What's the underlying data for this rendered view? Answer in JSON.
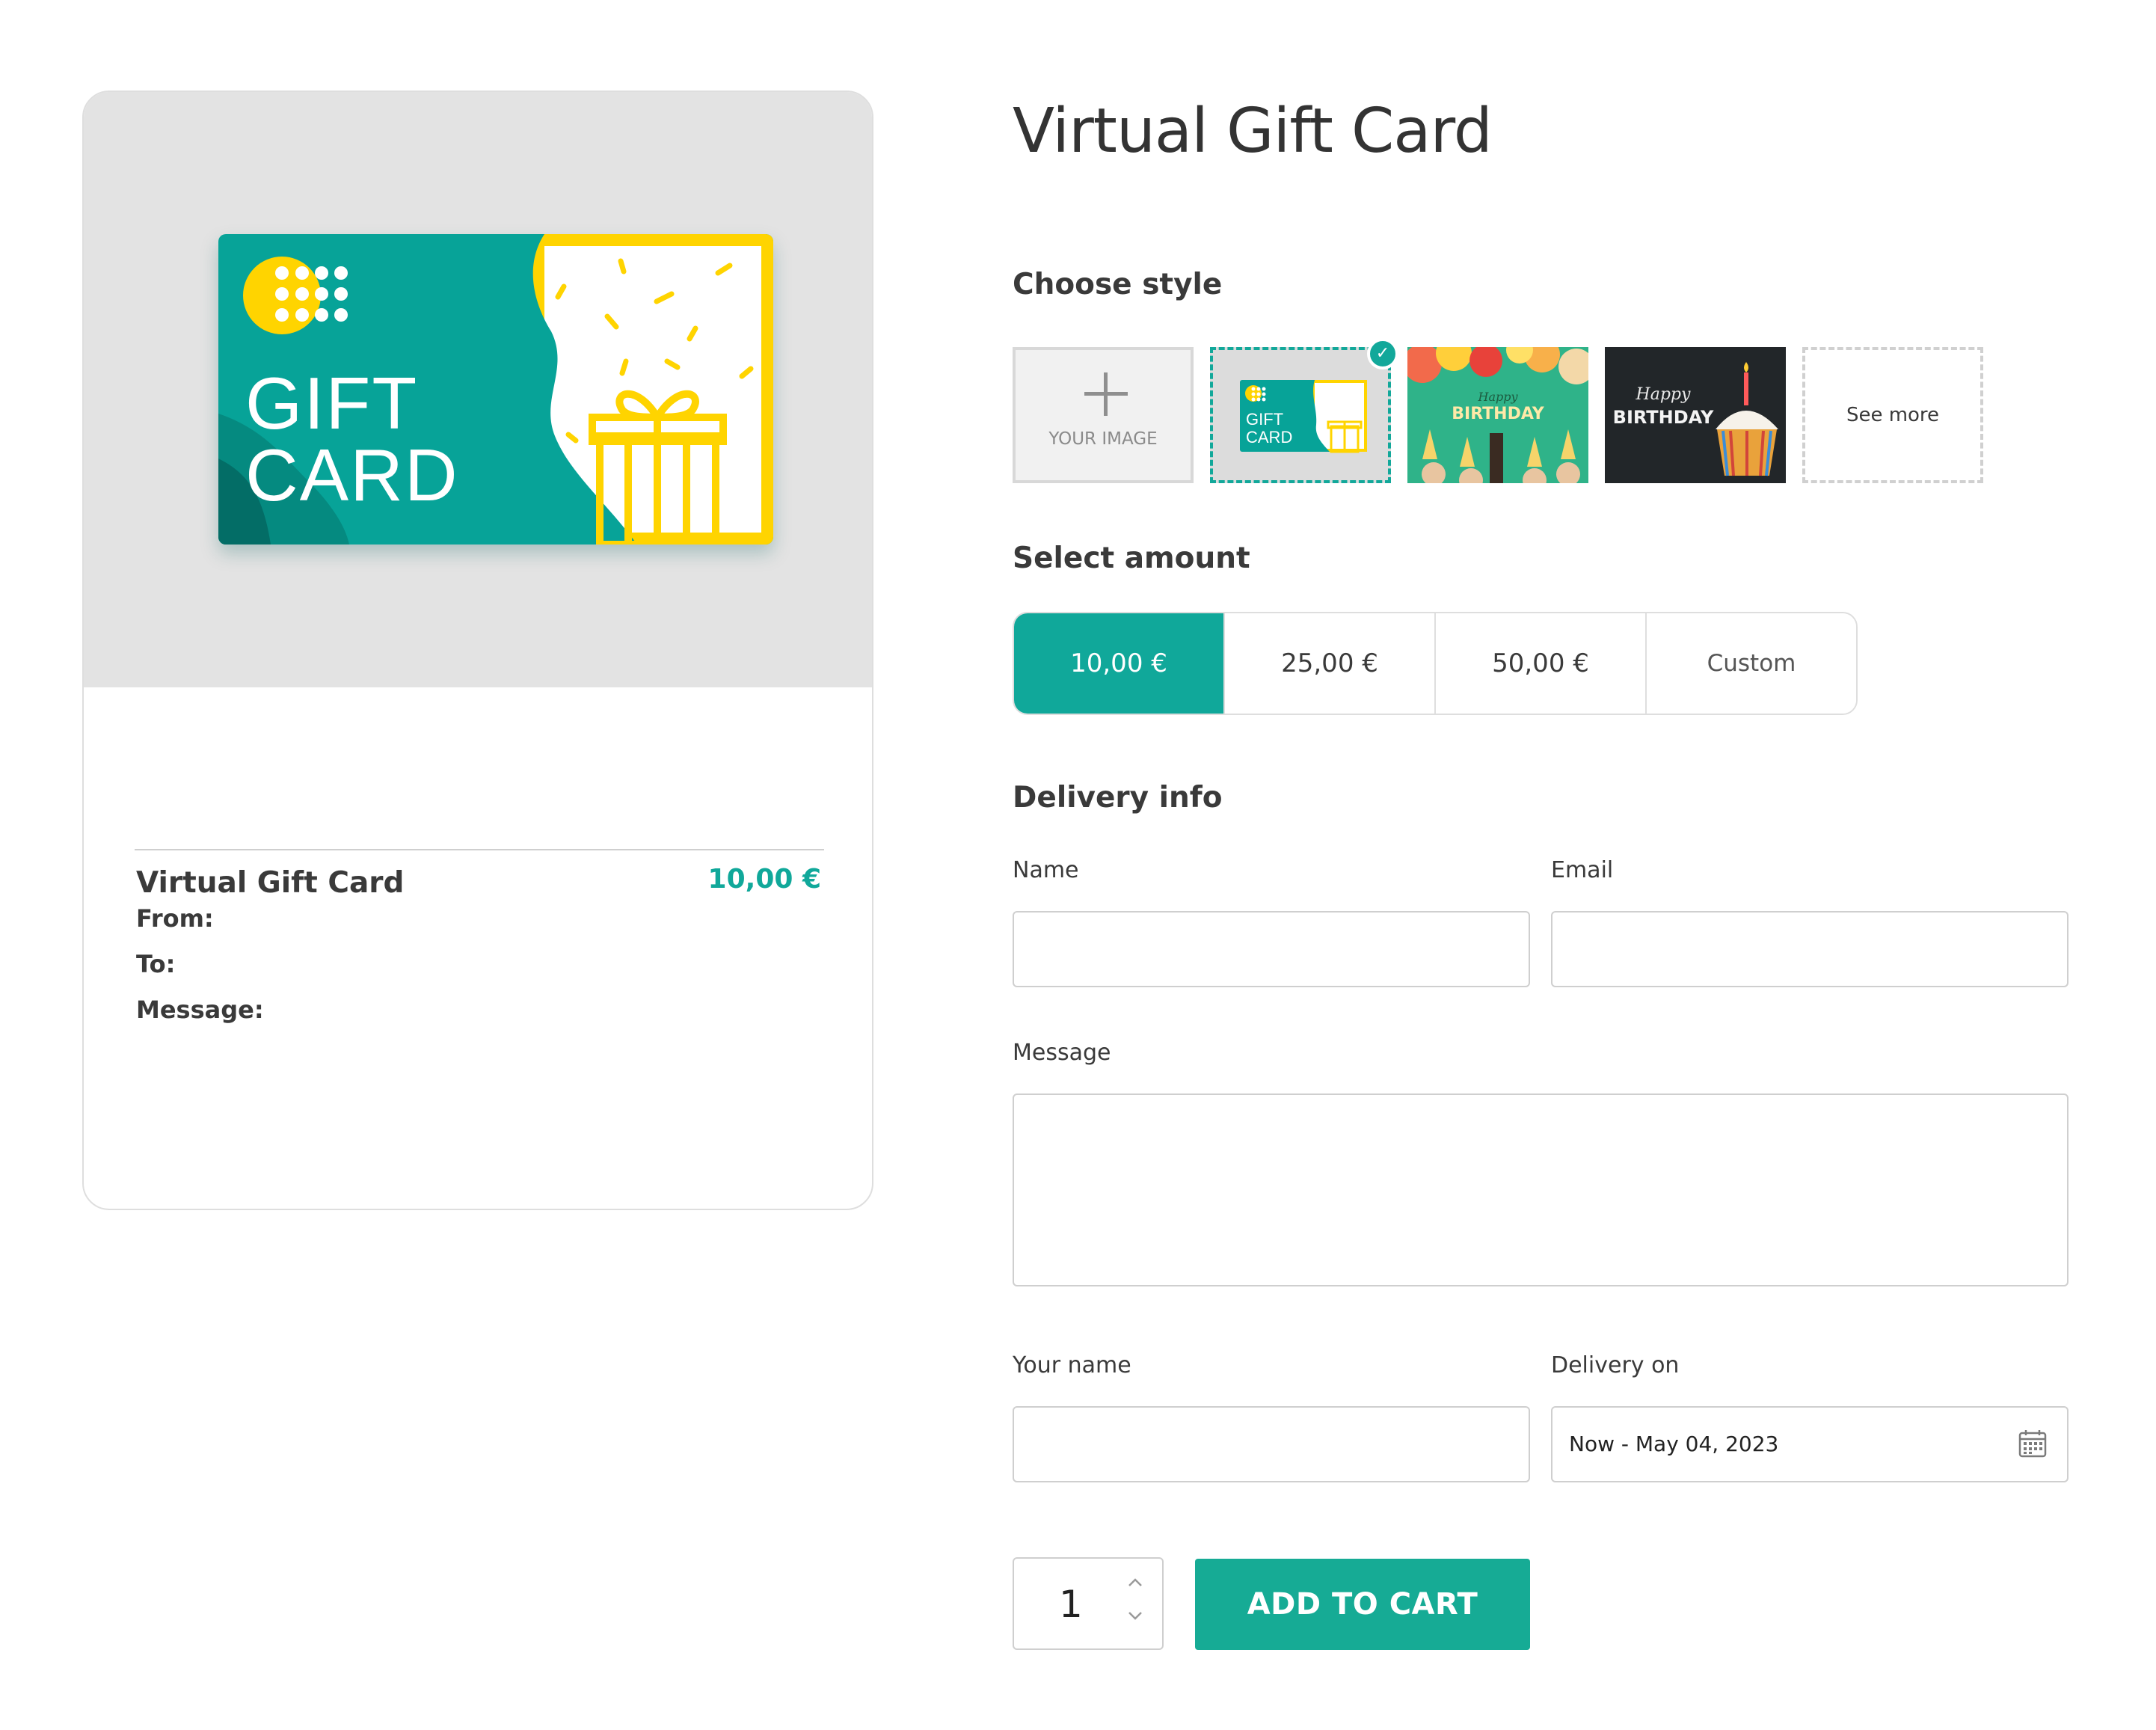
{
  "preview": {
    "card_text_line1": "GIFT",
    "card_text_line2": "CARD",
    "title": "Virtual Gift Card",
    "price": "10,00 €",
    "from_label": "From:",
    "to_label": "To:",
    "message_label": "Message:"
  },
  "product": {
    "title": "Virtual Gift Card"
  },
  "style_section": {
    "title": "Choose style",
    "own_image_label": "YOUR IMAGE",
    "selected_thumb_line1": "GIFT",
    "selected_thumb_line2": "CARD",
    "bday1_script": "Happy",
    "bday1_text": "BIRTHDAY",
    "bday2_script": "Happy",
    "bday2_text": "BIRTHDAY",
    "see_more_label": "See more"
  },
  "amount_section": {
    "title": "Select amount",
    "options": [
      "10,00 €",
      "25,00 €",
      "50,00 €",
      "Custom"
    ],
    "selected_index": 0
  },
  "delivery": {
    "title": "Delivery info",
    "name_label": "Name",
    "name_value": "",
    "email_label": "Email",
    "email_value": "",
    "message_label": "Message",
    "message_value": "",
    "your_name_label": "Your name",
    "your_name_value": "",
    "delivery_on_label": "Delivery on",
    "delivery_on_value": "Now - May 04, 2023"
  },
  "cart": {
    "quantity": "1",
    "add_to_cart_label": "ADD TO CART"
  },
  "colors": {
    "accent": "#10a89a",
    "card_teal": "#07a398",
    "card_yellow": "#ffd400",
    "cart_button": "#16ab95"
  },
  "icons": {
    "plus": "plus-icon",
    "check": "check-icon",
    "calendar": "calendar-icon",
    "stepper_up": "chevron-up-icon",
    "stepper_down": "chevron-down-icon",
    "gift": "gift-icon"
  }
}
